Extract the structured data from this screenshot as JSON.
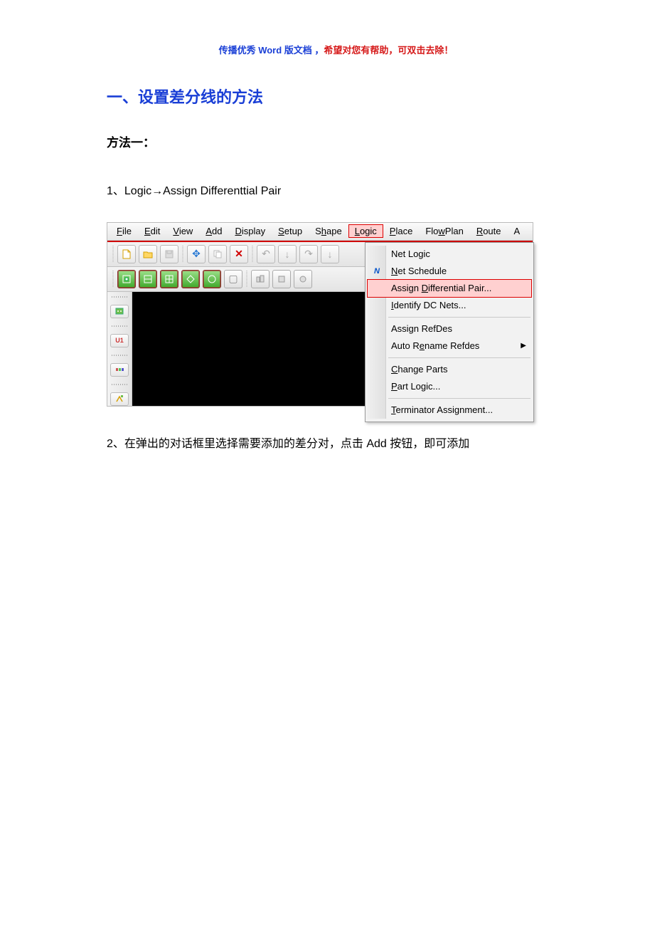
{
  "watermark_p1": "传播优秀 Word 版文档 ，",
  "watermark_p2": "希望对您有帮助，可双击去除！",
  "heading": "一、设置差分线的方法",
  "subheading": "方法一：",
  "step1": "1、Logic→Assign Differenttial Pair",
  "step2": "2、在弹出的对话框里选择需要添加的差分对，点击 Add 按钮，即可添加",
  "menubar": {
    "file": "File",
    "edit": "Edit",
    "view": "View",
    "add": "Add",
    "display": "Display",
    "setup": "Setup",
    "shape": "Shape",
    "logic": "Logic",
    "place": "Place",
    "flowplan": "FlowPlan",
    "route": "Route",
    "a": "A"
  },
  "dropdown": {
    "net_logic": "Net Logic",
    "net_schedule": "Net Schedule",
    "assign_diff": "Assign Differential Pair...",
    "identify_dc": "Identify DC Nets...",
    "assign_refdes": "Assign RefDes",
    "auto_rename": "Auto Rename Refdes",
    "change_parts": "Change Parts",
    "part_logic": "Part Logic...",
    "terminator": "Terminator Assignment..."
  },
  "icon_N": "N"
}
